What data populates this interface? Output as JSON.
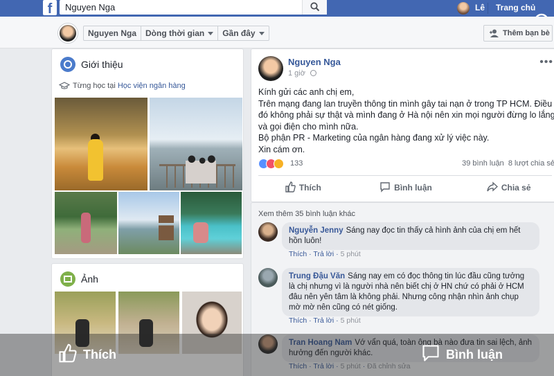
{
  "topbar": {
    "search_value": "Nguyen Nga",
    "user_name": "Lê",
    "home_label": "Trang chủ"
  },
  "profile_nav": {
    "name": "Nguyen Nga",
    "timeline_label": "Dòng thời gian",
    "recent_label": "Gần đây",
    "add_friend_label": "Thêm bạn bè"
  },
  "intro": {
    "title": "Giới thiệu",
    "studied_prefix": "Từng học tại",
    "studied_place": "Học viện ngân hàng"
  },
  "photos": {
    "title": "Ảnh"
  },
  "post": {
    "author": "Nguyen Nga",
    "time": "1 giờ",
    "lines": [
      "Kính gửi các anh chị em,",
      "Trên mạng đang lan truyền thông tin mình gây tai nạn ở trong TP HCM. Điều đó không phải sự thật và mình đang ở Hà nội nên xin mọi người đừng lo lắng và gọi điện cho mình nữa.",
      "Bộ phận PR - Marketing của ngân hàng đang xử lý việc này.",
      "Xin cám ơn."
    ],
    "reaction_count": "133",
    "comment_count": "39 bình luận",
    "share_count": "8 lượt chia sẻ",
    "like_label": "Thích",
    "comment_label": "Bình luận",
    "share_label": "Chia sẻ"
  },
  "comments": {
    "view_more": "Xem thêm 35 bình luận khác",
    "items": [
      {
        "name": "Nguyễn Jenny",
        "text": "Sáng nay đọc tin thấy cả hình ảnh của chị em hết hồn luôn!",
        "like": "Thích",
        "reply": "Trả lời",
        "time": "5 phút"
      },
      {
        "name": "Trung Đậu Văn",
        "text": "Sáng nay em có đọc thông tin lúc đầu cũng tưởng là chị nhưng vì là người nhà nên biết chị ở HN chứ có phải ở HCM đâu nên yên tâm là không phải. Nhưng công nhận nhìn ảnh chụp mờ mờ nên cũng có nét giống.",
        "like": "Thích",
        "reply": "Trả lời",
        "time": "5 phút"
      },
      {
        "name": "Tran Hoang Nam",
        "text": "Vớ vẩn quá, toàn ông bà nào đưa tin sai lệch, ảnh hưởng đến người khác.",
        "like": "Thích",
        "reply": "Trả lời",
        "time": "5 phút",
        "edited": "Đã chỉnh sửa"
      }
    ]
  },
  "overlay": {
    "like_label": "Thích",
    "comment_label": "Bình luận"
  }
}
